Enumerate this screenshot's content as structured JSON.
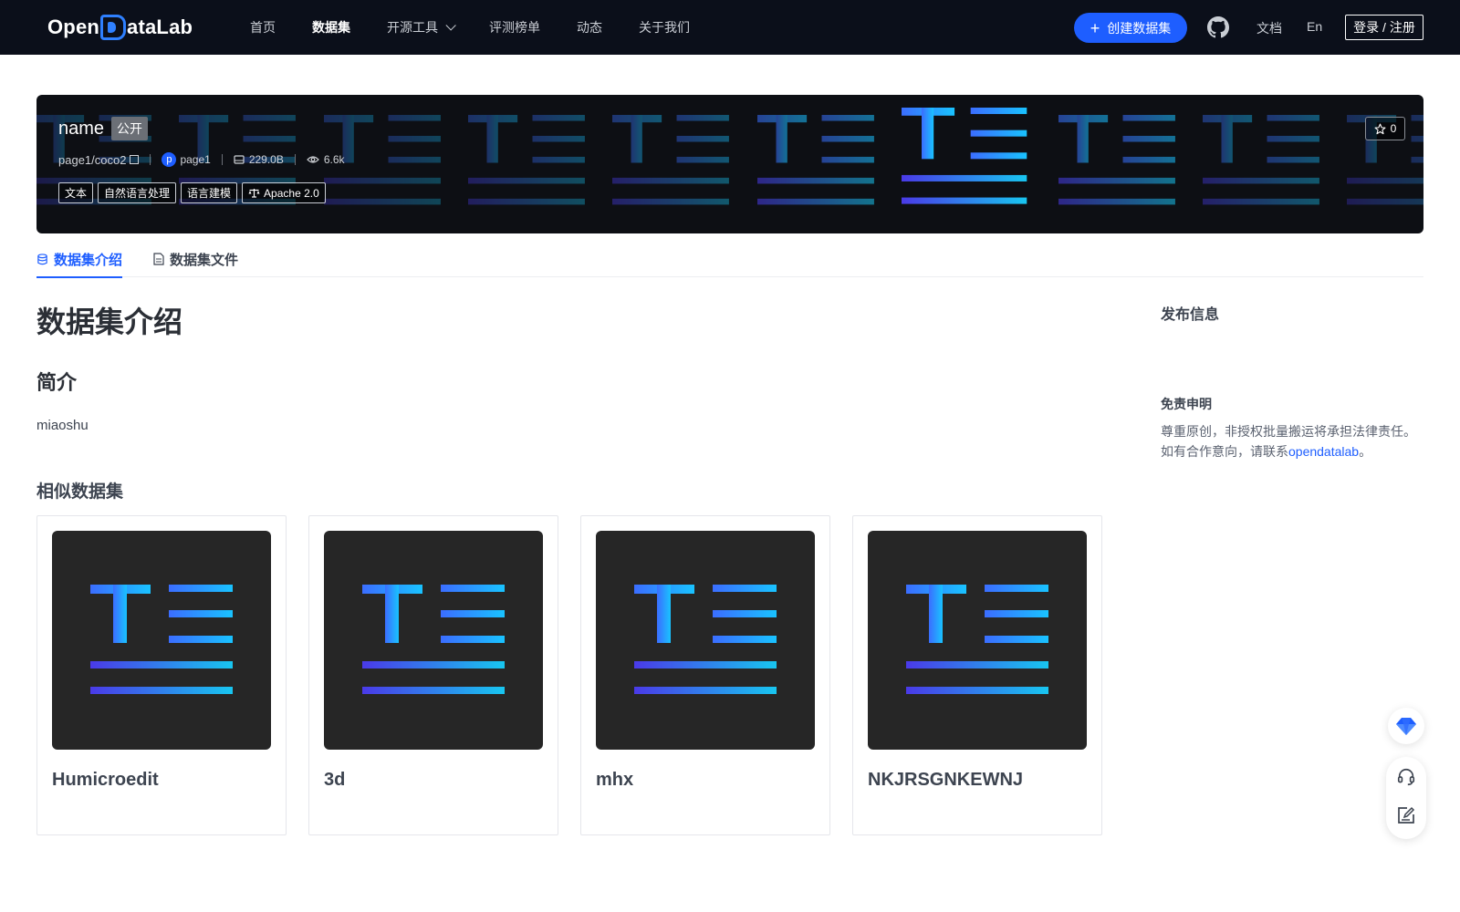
{
  "nav": {
    "logo": {
      "left": "Open",
      "right": "ataLab"
    },
    "links": [
      "首页",
      "数据集",
      "开源工具",
      "评测榜单",
      "动态",
      "关于我们"
    ],
    "active_index": 1,
    "create_label": "创建数据集",
    "docs": "文档",
    "lang": "En",
    "login": "登录 / 注册"
  },
  "banner": {
    "name": "name",
    "visibility": "公开",
    "path": "page1/coco2",
    "avatar_letter": "p",
    "owner": "page1",
    "size": "229.0B",
    "views": "6.6k",
    "tags": [
      "文本",
      "自然语言处理",
      "语言建模"
    ],
    "license": "Apache 2.0",
    "stars": "0"
  },
  "tabs": [
    "数据集介绍",
    "数据集文件"
  ],
  "main": {
    "title": "数据集介绍",
    "intro_heading": "简介",
    "description": "miaoshu",
    "similar_heading": "相似数据集",
    "similar": [
      {
        "name": "Humicroedit"
      },
      {
        "name": "3d"
      },
      {
        "name": "mhx"
      },
      {
        "name": "NKJRSGNKEWNJ"
      }
    ]
  },
  "sidebar": {
    "publish_title": "发布信息",
    "disclaimer_title": "免责申明",
    "disclaimer_line1": "尊重原创，非授权批量搬运将承担法律责任。",
    "disclaimer_line2_prefix": "如有合作意向，请联系",
    "disclaimer_link": "opendatalab",
    "disclaimer_line2_suffix": "。"
  },
  "colors": {
    "accent": "#1e5eff",
    "nav_bg": "#0b0f1a",
    "thumb_bg": "#262626"
  }
}
